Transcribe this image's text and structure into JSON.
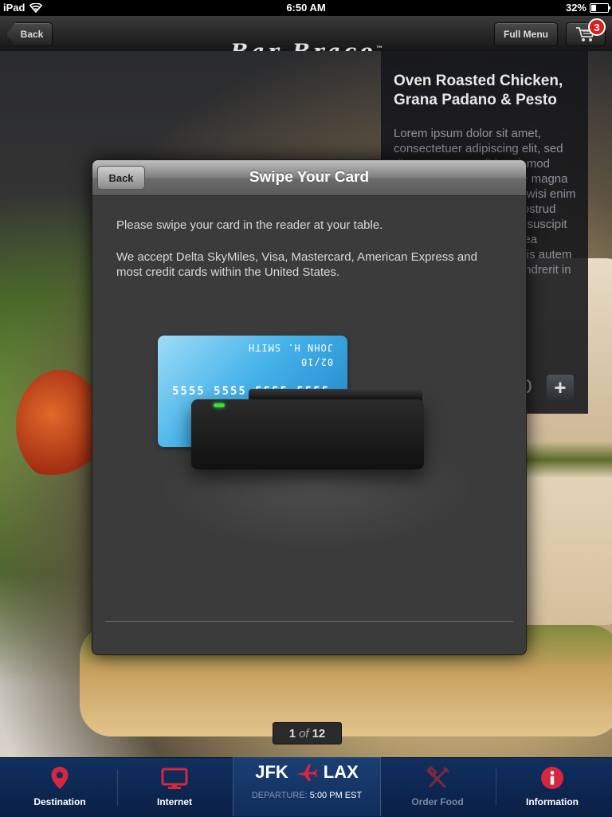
{
  "status_bar": {
    "device": "iPad",
    "time": "6:50 AM",
    "battery": "32%",
    "battery_level": 0.32
  },
  "nav": {
    "back_label": "Back",
    "logo_text": "Bar Brace",
    "logo_tm": "™",
    "full_menu_label": "Full Menu",
    "cart_count": "3"
  },
  "product": {
    "title": "Oven Roasted Chicken, Grana Padano & Pesto",
    "description": "Lorem ipsum dolor sit amet, consectetuer adipiscing elit, sed diam nonummy nibh euismod tincidunt ut laoreet dolore magna aliquam erat volutpat. Ut wisi enim ad minim veniam, quis nostrud exerci tation ullamcorper suscipit lobortis nisl ut aliquip ex ea commodo consequat. Duis autem vel eum iriure dolor in hendrerit in vulputate.",
    "quantity": "0",
    "plus_label": "+"
  },
  "modal": {
    "back_label": "Back",
    "title": "Swipe Your Card",
    "instruction": "Please swipe your card in the reader at your table.",
    "accepted": "We accept Delta SkyMiles, Visa, Mastercard, American Express and most credit cards within the United States.",
    "card": {
      "name": "JOHN H. SMITH",
      "expiry": "02/10",
      "number": "5555 5555 5555 5555"
    }
  },
  "pager": {
    "current": "1",
    "of": "of",
    "total": "12"
  },
  "tab_bar": {
    "tabs": [
      {
        "label": "Destination",
        "icon": "map-pin-icon"
      },
      {
        "label": "Internet",
        "icon": "monitor-icon"
      },
      {
        "label": "Order Food",
        "icon": "fork-knife-icon"
      },
      {
        "label": "Information",
        "icon": "info-icon"
      }
    ],
    "flight": {
      "from": "JFK",
      "to": "LAX",
      "departure_label": "DEPARTURE:",
      "departure_time": "5:00 PM EST"
    }
  },
  "colors": {
    "tab_bar": "#0f2c5a",
    "accent_red": "#d61f1f",
    "card_blue": "#45b2ea",
    "led_green": "#3bdc3b"
  }
}
